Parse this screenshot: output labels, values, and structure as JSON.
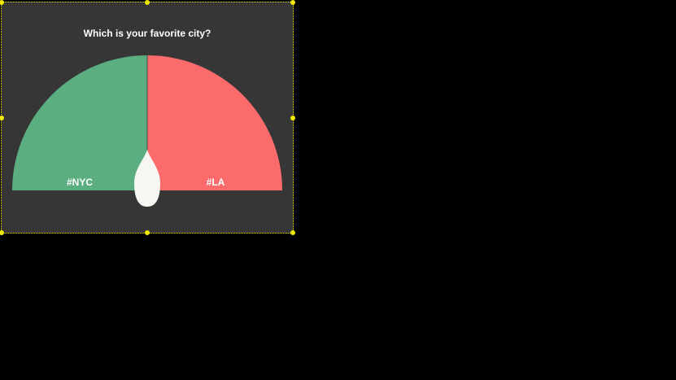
{
  "poll": {
    "question": "Which is your favorite city?",
    "options": [
      {
        "label": "#NYC",
        "share": 0.5,
        "color": "#5aae80"
      },
      {
        "label": "#LA",
        "share": 0.5,
        "color": "#fc6b6b"
      }
    ],
    "needle_color": "#f7f7f1",
    "background_color": "#363636"
  }
}
